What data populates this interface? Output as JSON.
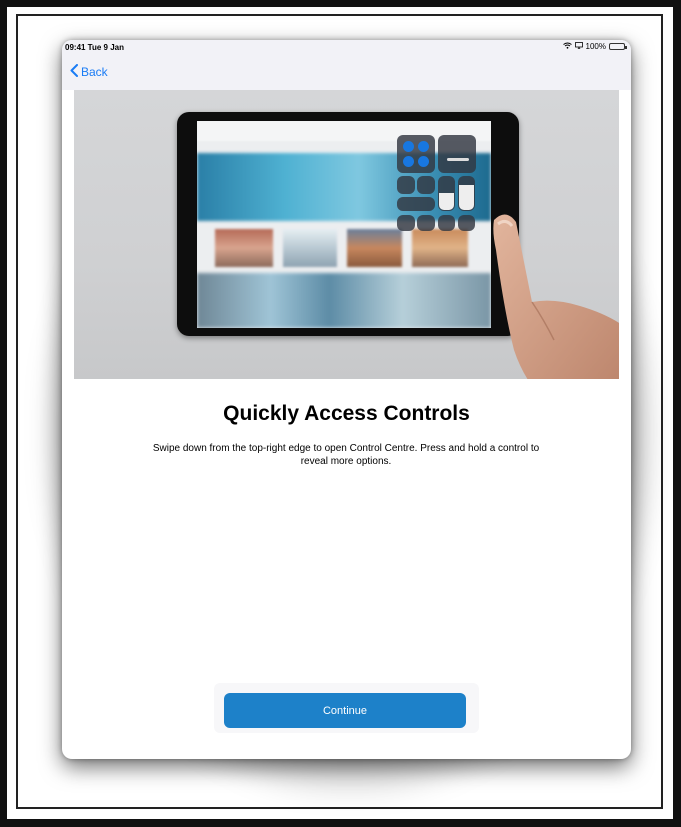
{
  "status_bar": {
    "time": "09:41  Tue 9 Jan",
    "battery_text": "100%"
  },
  "nav": {
    "back_label": "Back"
  },
  "main": {
    "title": "Quickly Access Controls",
    "description": "Swipe down from the top-right edge to open Control Centre. Press and hold a control to reveal more options.",
    "continue_label": "Continue"
  },
  "colors": {
    "accent": "#1a7cf5",
    "continue_button": "#1d81c9",
    "battery_green": "#34c759"
  },
  "icons": {
    "back": "chevron-left-icon",
    "wifi": "wifi-icon",
    "battery": "battery-icon"
  }
}
